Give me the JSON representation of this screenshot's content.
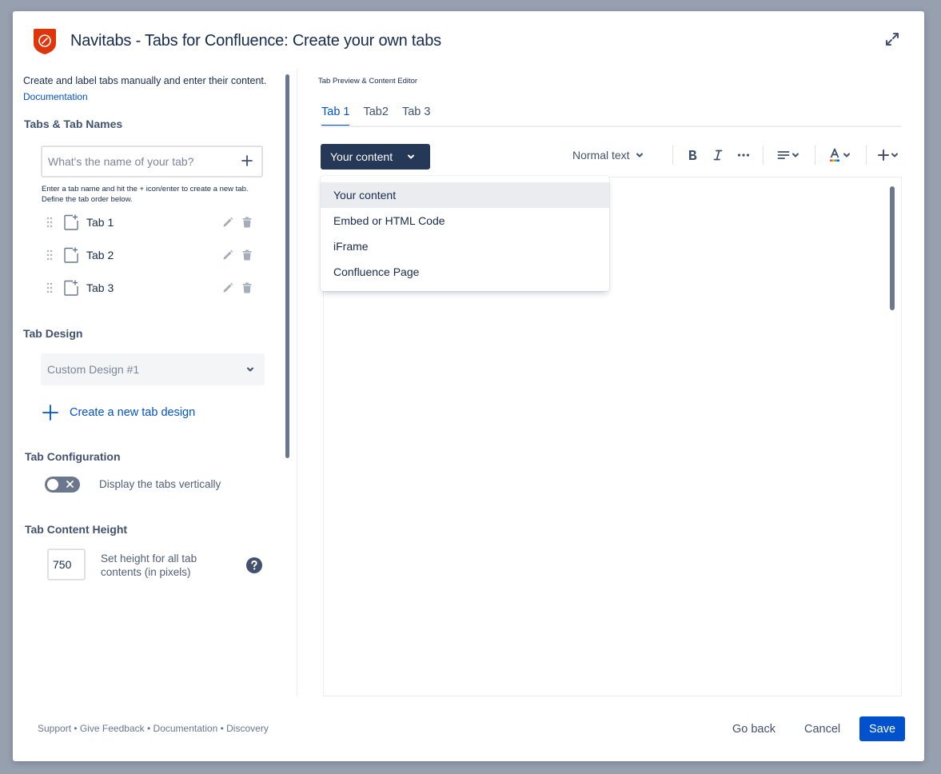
{
  "header": {
    "title": "Navitabs - Tabs for Confluence: Create your own tabs",
    "brand_color": "#de350b"
  },
  "sidebar": {
    "intro": "Create and label tabs manually and enter their content.",
    "doc_link": "Documentation",
    "tabs_heading": "Tabs & Tab Names",
    "tab_name_placeholder": "What's the name of your tab?",
    "tab_name_hint": "Enter a tab name and hit the + icon/enter  to create a new tab. Define the tab order below.",
    "tabs": [
      {
        "label": "Tab 1"
      },
      {
        "label": "Tab 2"
      },
      {
        "label": "Tab 3"
      }
    ],
    "design_heading": "Tab Design",
    "design_selected": "Custom Design #1",
    "create_design_label": "Create a new tab design",
    "config_heading": "Tab Configuration",
    "vertical_toggle_label": "Display the tabs vertically",
    "vertical_toggle_on": false,
    "height_heading": "Tab Content Height",
    "height_value": "750",
    "height_label": "Set height for all tab contents (in pixels)"
  },
  "editor": {
    "caption": "Tab Preview & Content Editor",
    "tabs": [
      {
        "label": "Tab 1",
        "active": true
      },
      {
        "label": "Tab2",
        "active": false
      },
      {
        "label": "Tab 3",
        "active": false
      }
    ],
    "content_type_label": "Your content",
    "text_style_label": "Normal text",
    "dropdown_options": [
      {
        "label": "Your content",
        "selected": true
      },
      {
        "label": "Embed or HTML Code",
        "selected": false
      },
      {
        "label": "iFrame",
        "selected": false
      },
      {
        "label": "Confluence Page",
        "selected": false
      }
    ]
  },
  "footer": {
    "links": [
      "Support",
      "Give Feedback",
      "Documentation",
      "Discovery"
    ],
    "separator": "•",
    "go_back_label": "Go back",
    "cancel_label": "Cancel",
    "save_label": "Save",
    "accent_color": "#0052cc"
  }
}
